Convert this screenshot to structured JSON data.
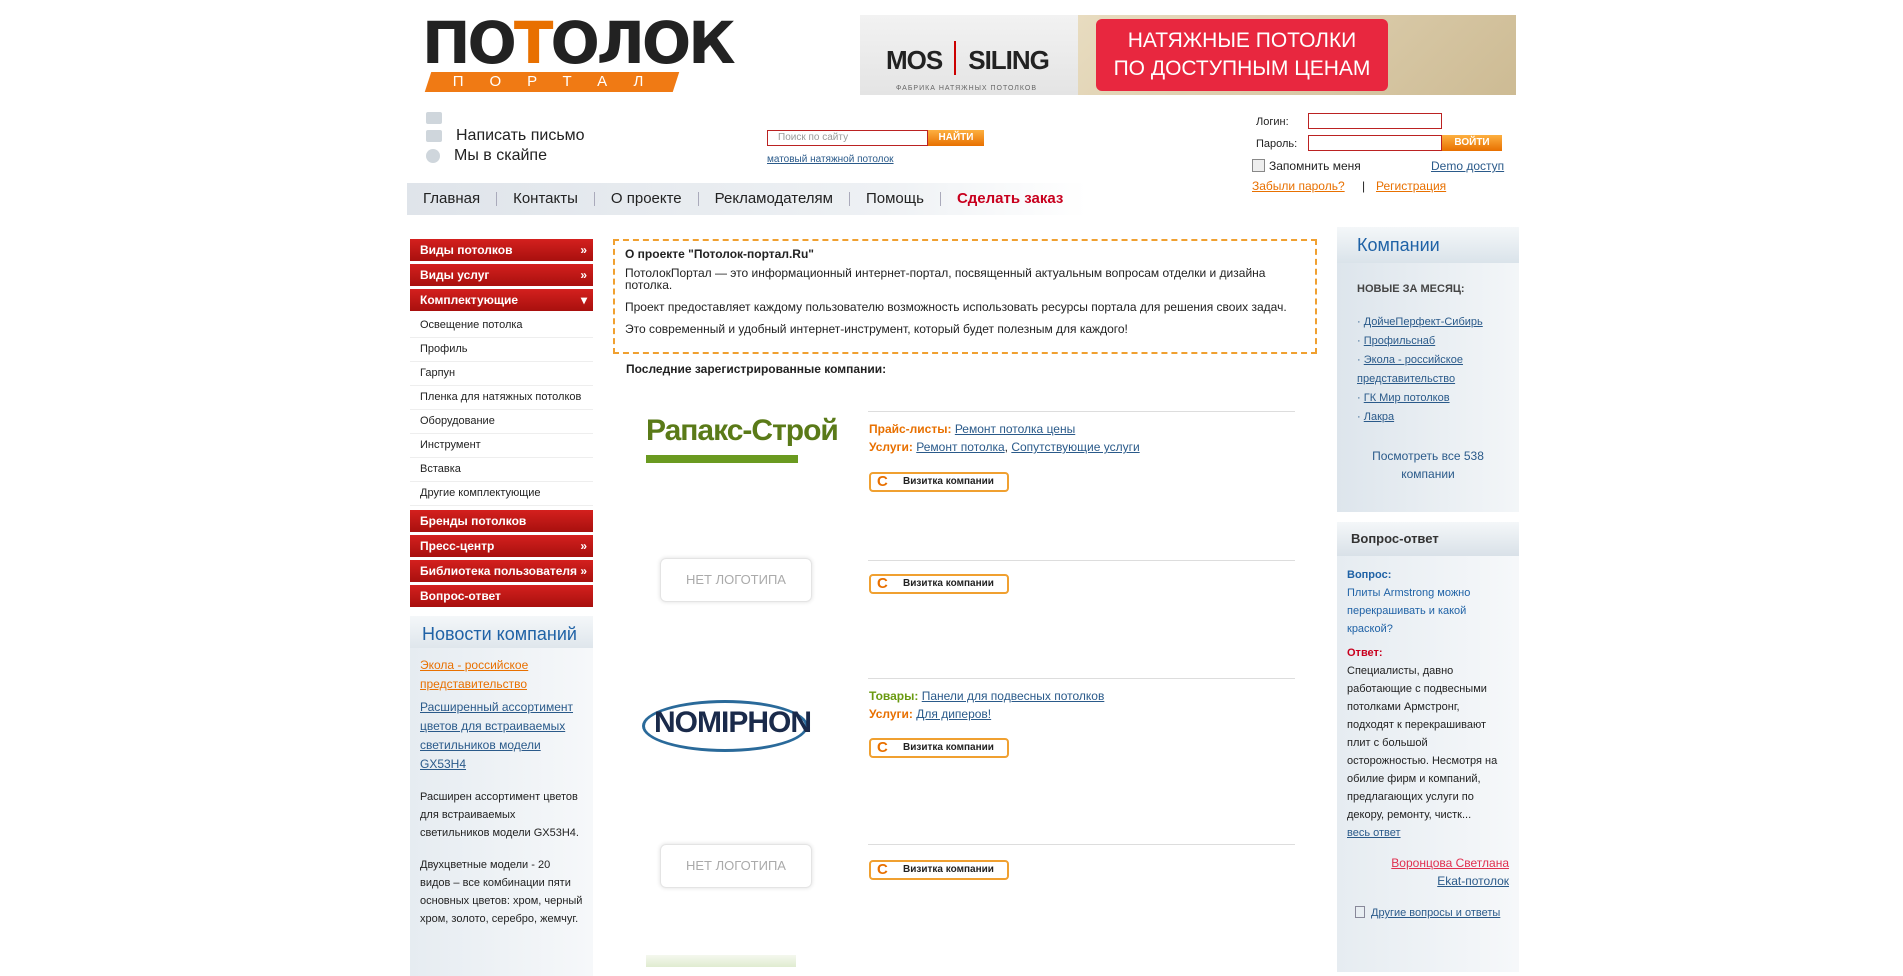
{
  "logo": {
    "word_a": "ПО",
    "word_o": "Т",
    "word_b": "ОЛОК",
    "band": "ПОРТАЛ"
  },
  "banner": {
    "brand_a": "MOS",
    "brand_b": "SILING",
    "sub": "ФАБРИКА НАТЯЖНЫХ ПОТОЛКОВ",
    "line1": "НАТЯЖНЫЕ ПОТОЛКИ",
    "line2": "ПО ДОСТУПНЫМ ЦЕНАМ"
  },
  "contacts": {
    "write": "Написать письмо",
    "skype": "Мы в скайпе"
  },
  "search": {
    "placeholder": "Поиск по сайту",
    "button": "НАЙТИ",
    "hint": "матовый натяжной потолок"
  },
  "login": {
    "login_label": "Логин:",
    "password_label": "Пароль:",
    "button": "ВОЙТИ",
    "remember": "Запомнить меня",
    "demo": "Demo доступ",
    "forgot": "Забыли пароль?",
    "separator": "|",
    "register": "Регистрация"
  },
  "nav": [
    "Главная",
    "Контакты",
    "О проекте",
    "Рекламодателям",
    "Помощь",
    "Сделать заказ"
  ],
  "leftmenu": {
    "top": [
      {
        "label": "Виды потолков",
        "arrow": "»"
      },
      {
        "label": "Виды услуг",
        "arrow": "»"
      },
      {
        "label": "Комплектующие",
        "arrow": "▾"
      }
    ],
    "sub": [
      "Освещение потолка",
      "Профиль",
      "Гарпун",
      "Пленка для натяжных потолков",
      "Оборудование",
      "Инструмент",
      "Вставка",
      "Другие комплектующие"
    ],
    "bottom": [
      {
        "label": "Бренды потолков",
        "arrow": ""
      },
      {
        "label": "Пресс-центр",
        "arrow": "»"
      },
      {
        "label": "Библиотека пользователя",
        "arrow": "»"
      },
      {
        "label": "Вопрос-ответ",
        "arrow": ""
      }
    ]
  },
  "news": {
    "title": "Новости компаний",
    "company": "Экола - российское представительство",
    "headline": "Расширенный ассортимент цветов для встраиваемых светильников модели GX53H4",
    "p1": "Расширен ассортимент цветов для встраиваемых светильников модели GX53H4.",
    "p2": "Двухцветные модели - 20 видов  – все комбинации пяти основных цветов: хром,  черный хром, золото, серебро, жемчуг."
  },
  "about": {
    "title": "О проекте \"Потолок-портал.Ru\"",
    "p1": "ПотолокПортал — это информационный интернет-портал, посвященный актуальным вопросам отделки и дизайна потолка.",
    "p2": "Проект предоставляет каждому пользователю возможность использовать ресурсы портала для решения своих задач.",
    "p3": "Это современный и удобный интернет-инструмент, который будет полезным для каждого!"
  },
  "lastreg": "Последние зарегистрированные компании:",
  "companies_list": {
    "visit": "Визитка компании",
    "nologo": "НЕТ ЛОГОТИПА",
    "c1": {
      "logo": "Рапакс-Строй",
      "k1": "Прайс-листы:",
      "v1": "Ремонт потолка цены",
      "k2": "Услуги:",
      "v2a": "Ремонт потолка",
      "v2b": "Сопутствующие услуги"
    },
    "c3": {
      "logo": "NOMIPHON",
      "k1": "Товары:",
      "v1": "Панели для подвесных потолков",
      "k2": "Услуги:",
      "v2": "Для диперов!"
    }
  },
  "right_companies": {
    "title": "Компании",
    "section": "НОВЫЕ ЗА МЕСЯЦ:",
    "items": [
      "ДойчеПерфект-Сибирь",
      "Профильснаб",
      "Экола - российское представительство",
      "ГК Мир потолков",
      "Лакра"
    ],
    "all": "Посмотреть все 538 компании"
  },
  "qa": {
    "title": "Вопрос-ответ",
    "q_label": "Вопрос:",
    "q_text": "Плиты Armstrong можно перекрашивать и какой краской?",
    "a_label": "Ответ:",
    "a_text": "Специалисты, давно работающие с подвесными потолками Армстронг, подходят к перекрашивают плит с большой осторожностью. Несмотря на обилие фирм и компаний, предлагающих услуги по декору, ремонту, чистк...",
    "more": "весь ответ",
    "author": "Воронцова Светлана",
    "company": "Ekat-потолок",
    "other": "Другие вопросы и ответы"
  }
}
